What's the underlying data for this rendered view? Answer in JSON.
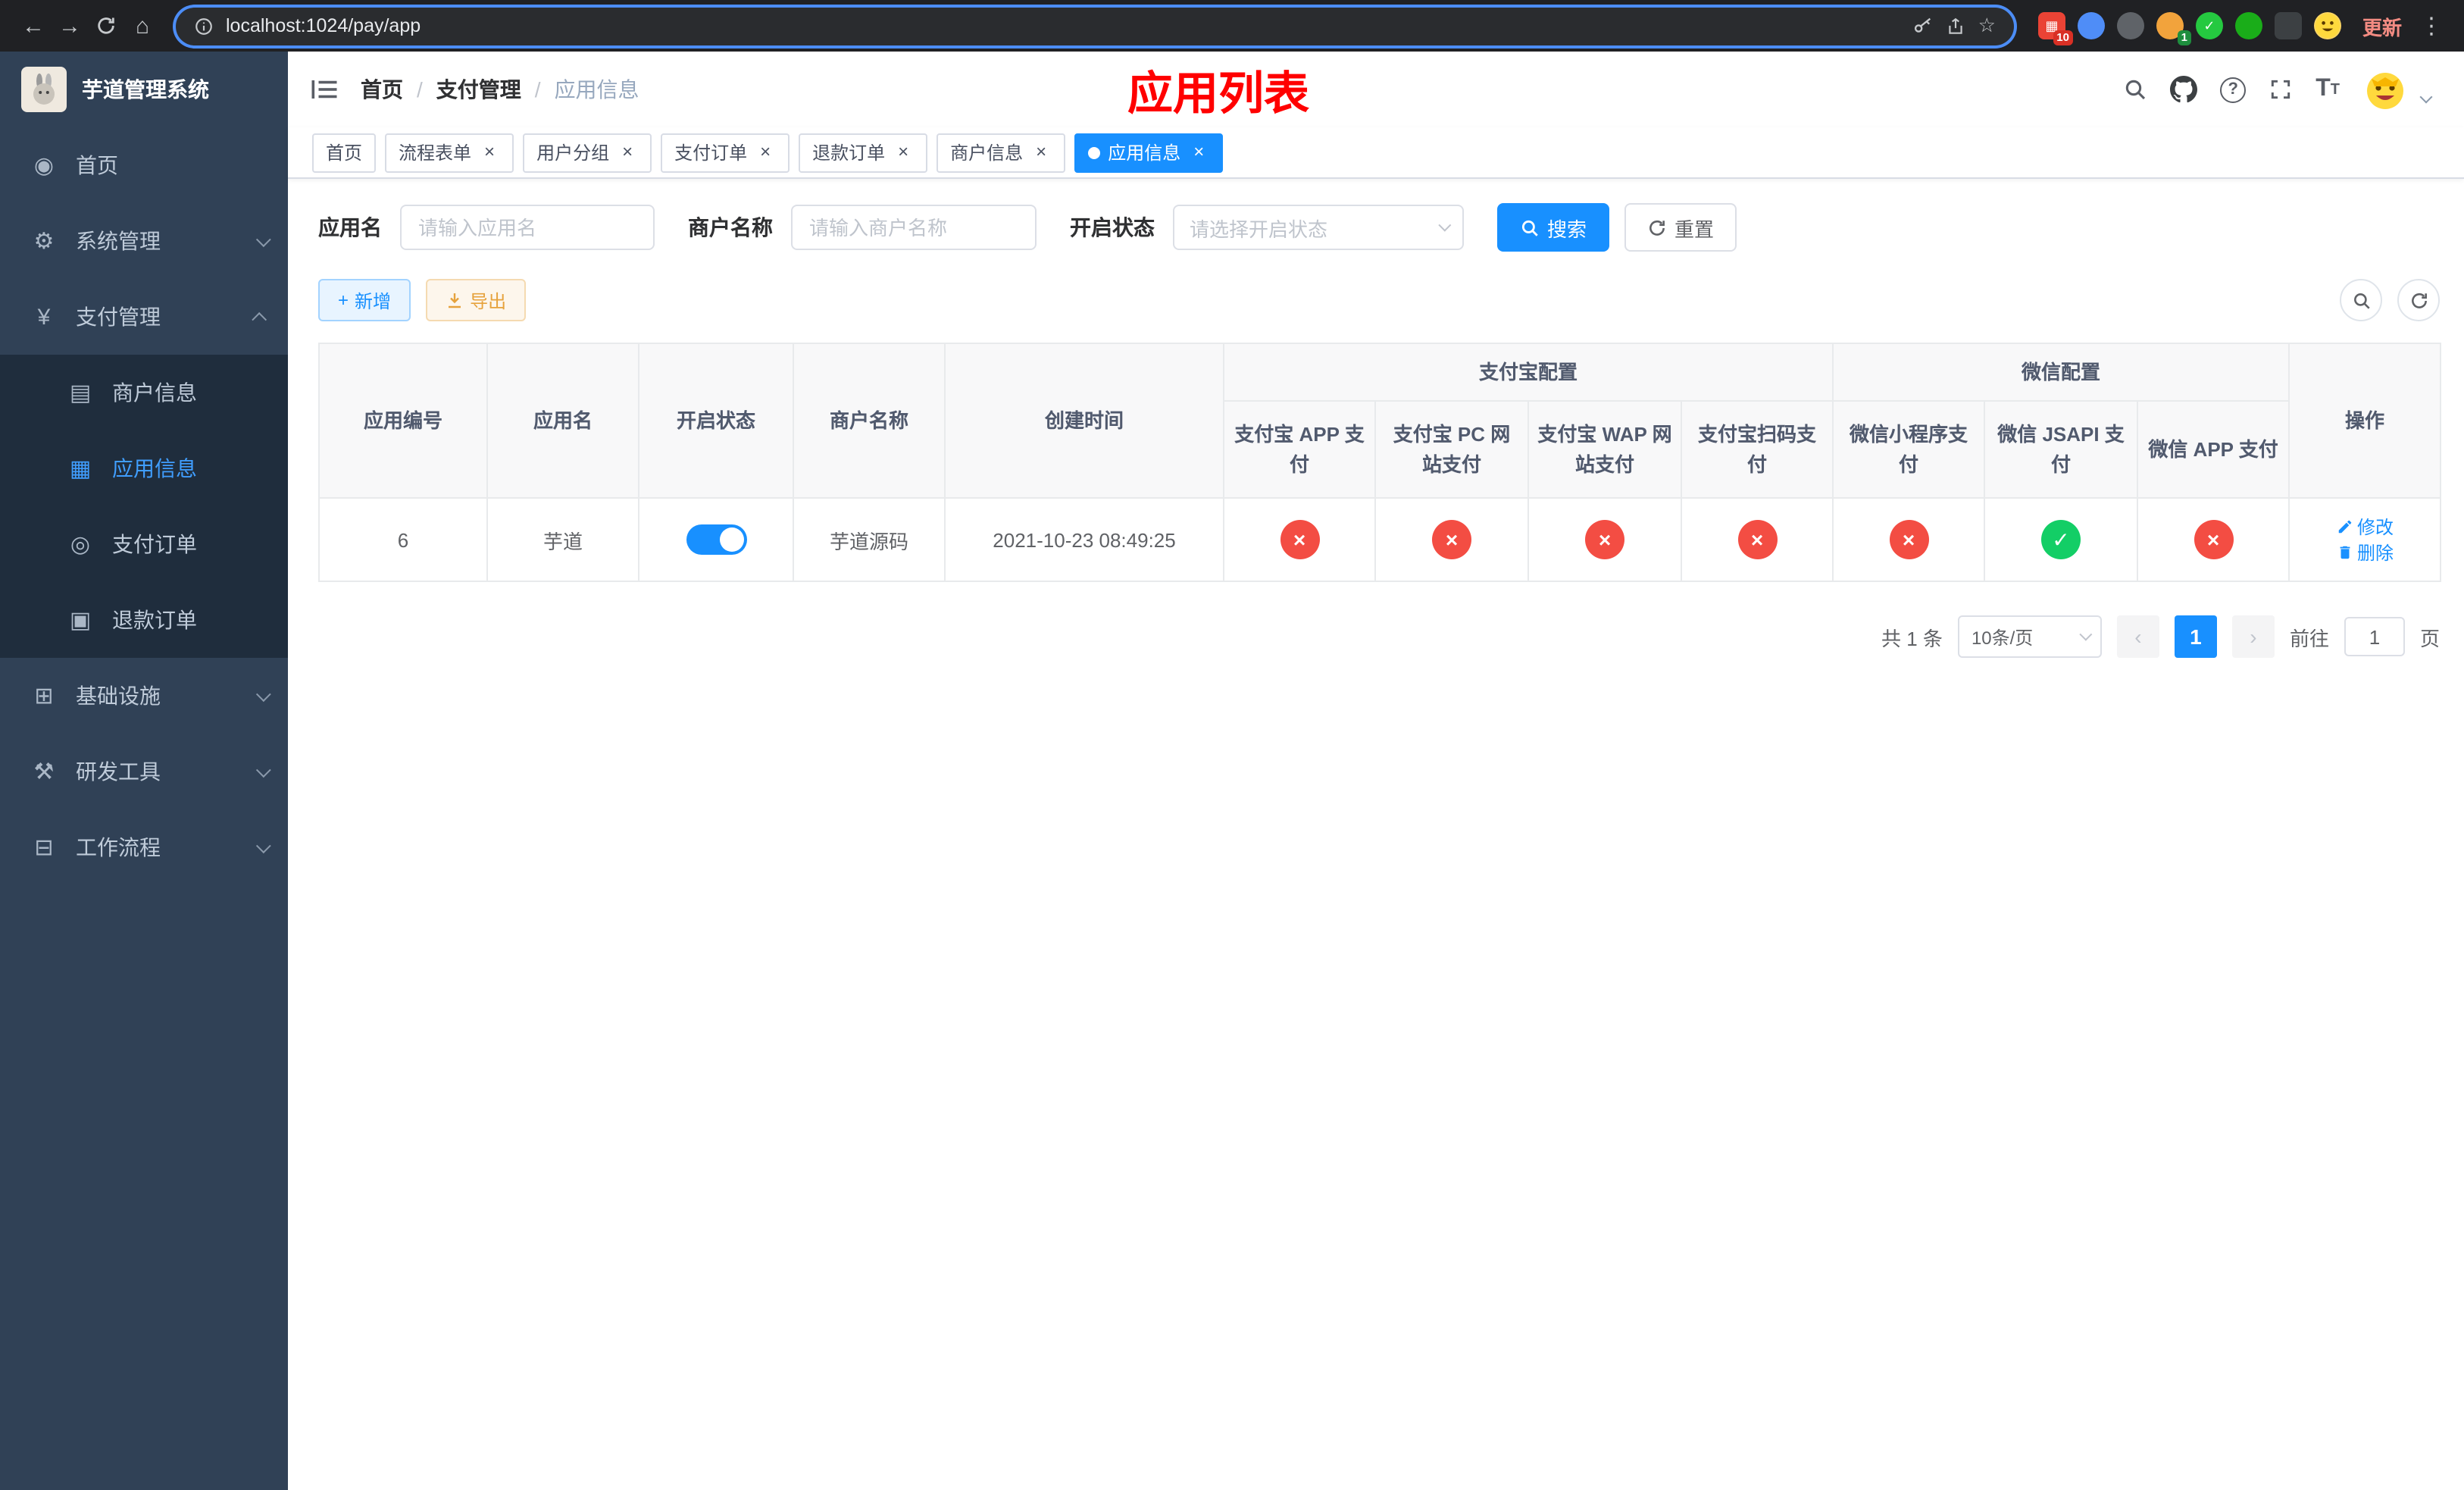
{
  "colors": {
    "accent": "#1890ff",
    "sidebar_bg": "#304156",
    "submenu_bg": "#1f2d3d",
    "danger": "#f34d43",
    "success": "#13ce66",
    "title_red": "#ff0000"
  },
  "browser": {
    "url": "localhost:1024/pay/app",
    "update_label": "更新",
    "extension_badge_red": "10",
    "extension_badge_green": "1"
  },
  "sidebar": {
    "logo_title": "芋道管理系统",
    "items": [
      {
        "label": "首页"
      },
      {
        "label": "系统管理"
      },
      {
        "label": "支付管理"
      },
      {
        "label": "基础设施"
      },
      {
        "label": "研发工具"
      },
      {
        "label": "工作流程"
      }
    ],
    "payment_children": [
      {
        "label": "商户信息"
      },
      {
        "label": "应用信息"
      },
      {
        "label": "支付订单"
      },
      {
        "label": "退款订单"
      }
    ]
  },
  "header": {
    "breadcrumb": [
      "首页",
      "支付管理",
      "应用信息"
    ],
    "breadcrumb_separator": "/",
    "page_title": "应用列表"
  },
  "tabs": [
    {
      "label": "首页"
    },
    {
      "label": "流程表单"
    },
    {
      "label": "用户分组"
    },
    {
      "label": "支付订单"
    },
    {
      "label": "退款订单"
    },
    {
      "label": "商户信息"
    },
    {
      "label": "应用信息"
    }
  ],
  "filters": {
    "app_name_label": "应用名",
    "app_name_placeholder": "请输入应用名",
    "merchant_label": "商户名称",
    "merchant_placeholder": "请输入商户名称",
    "status_label": "开启状态",
    "status_placeholder": "请选择开启状态",
    "search_label": "搜索",
    "reset_label": "重置"
  },
  "toolbar": {
    "add_label": "新增",
    "export_label": "导出"
  },
  "table": {
    "headers": {
      "app_id": "应用编号",
      "app_name": "应用名",
      "status": "开启状态",
      "merchant": "商户名称",
      "created": "创建时间",
      "alipay_group": "支付宝配置",
      "wechat_group": "微信配置",
      "actions": "操作",
      "alipay_cols": [
        "支付宝 APP 支付",
        "支付宝 PC 网站支付",
        "支付宝 WAP 网站支付",
        "支付宝扫码支付"
      ],
      "wechat_cols": [
        "微信小程序支付",
        "微信 JSAPI 支付",
        "微信 APP 支付"
      ]
    },
    "rows": [
      {
        "app_id": "6",
        "app_name": "芋道",
        "enabled": true,
        "merchant": "芋道源码",
        "created": "2021-10-23 08:49:25",
        "configs": [
          "no",
          "no",
          "no",
          "no",
          "no",
          "yes",
          "no"
        ],
        "edit_label": "修改",
        "delete_label": "删除"
      }
    ]
  },
  "pagination": {
    "total": "共 1 条",
    "page_size": "10条/页",
    "current_page": "1",
    "goto_prefix": "前往",
    "goto_value": "1",
    "goto_suffix": "页"
  }
}
